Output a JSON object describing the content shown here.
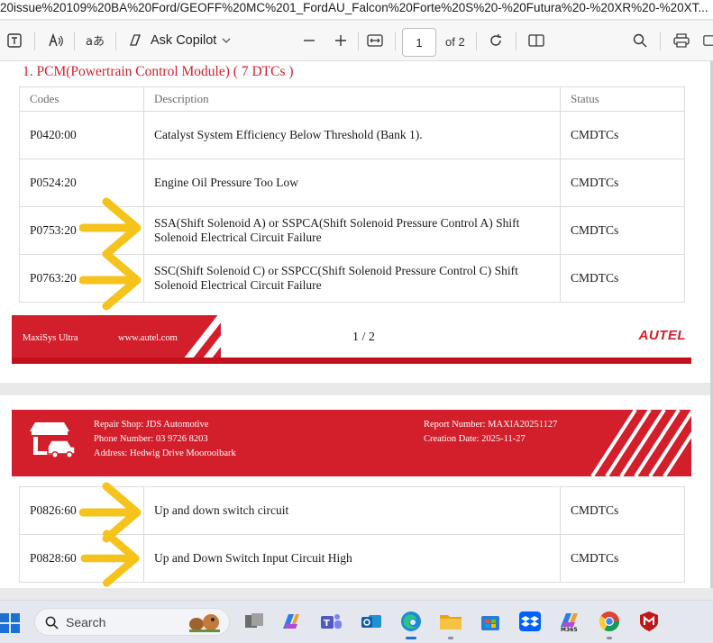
{
  "browser": {
    "url_title": "20issue%20109%20BA%20Ford/GEOFF%20MC%201_FordAU_Falcon%20Forte%20S%20-%20Futura%20-%20XR%20-%20XT..."
  },
  "toolbar": {
    "copilot_label": "Ask Copilot",
    "page_current": "1",
    "page_total": "of 2"
  },
  "section": {
    "title": "1.   PCM(Powertrain Control Module) ( 7 DTCs )"
  },
  "table": {
    "headers": [
      "Codes",
      "Description",
      "Status"
    ],
    "rows_page1": [
      {
        "code": "P0420:00",
        "description": "Catalyst System Efficiency Below Threshold (Bank 1).",
        "status": "CMDTCs"
      },
      {
        "code": "P0524:20",
        "description": "Engine Oil Pressure Too Low",
        "status": "CMDTCs"
      },
      {
        "code": "P0753:20",
        "description": "SSA(Shift Solenoid A) or SSPCA(Shift Solenoid Pressure Control A) Shift Solenoid Electrical Circuit Failure",
        "status": "CMDTCs"
      },
      {
        "code": "P0763:20",
        "description": "SSC(Shift Solenoid C) or SSPCC(Shift Solenoid Pressure Control C) Shift Solenoid Electrical Circuit Failure",
        "status": "CMDTCs"
      }
    ],
    "rows_page2": [
      {
        "code": "P0826:60",
        "description": "Up and down switch circuit",
        "status": "CMDTCs"
      },
      {
        "code": "P0828:60",
        "description": "Up and Down Switch Input Circuit High",
        "status": "CMDTCs"
      }
    ]
  },
  "footer": {
    "product": "MaxiSys Ultra",
    "website": "www.autel.com",
    "page_number": "1 / 2",
    "logo": "AUTEL"
  },
  "report_header": {
    "repair_shop": "Repair Shop:   JDS Automotive",
    "phone": "Phone Number:   03 9726 8203",
    "address": "Address:   Hedwig Drive Mooroolbark",
    "report_number": "Report Number:   MAXIA20251127",
    "creation_date": "Creation Date:   2025-11-27"
  },
  "taskbar": {
    "search_placeholder": "Search",
    "m365_label": "M365"
  },
  "colors": {
    "autel_red": "#d21f2b",
    "annotation_yellow": "#f5c31c",
    "edge_blue": "#1c6fd4"
  }
}
